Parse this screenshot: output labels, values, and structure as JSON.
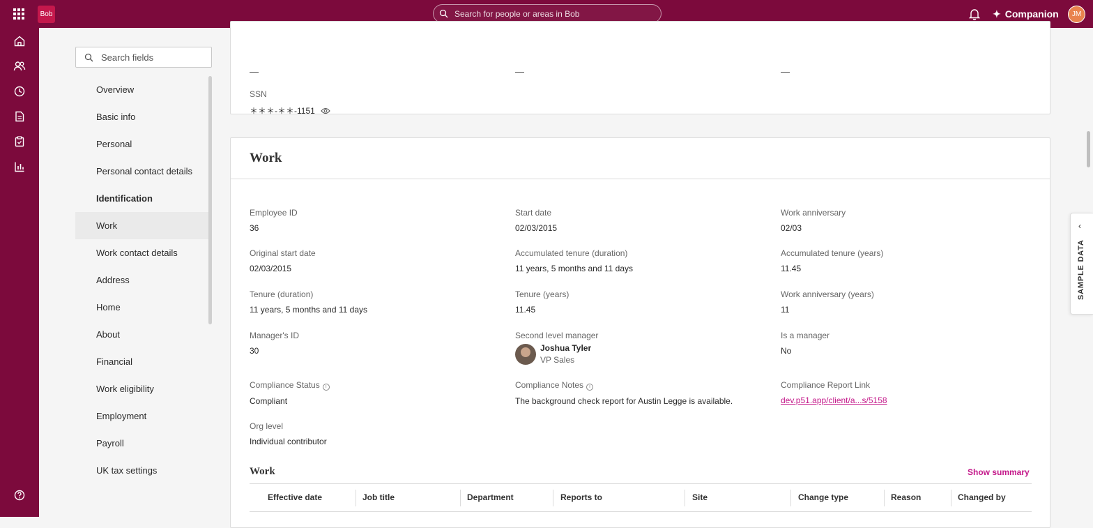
{
  "topbar": {
    "logo_text": "Bob",
    "search_placeholder": "Search for people or areas in Bob",
    "companion_label": "Companion",
    "user_initials": "JM"
  },
  "sidenav": [
    "home-icon",
    "people-icon",
    "time-icon",
    "documents-icon",
    "tasks-icon",
    "analytics-icon",
    "help-icon"
  ],
  "fields": {
    "search_placeholder": "Search fields",
    "items": [
      {
        "label": "Overview"
      },
      {
        "label": "Basic info"
      },
      {
        "label": "Personal"
      },
      {
        "label": "Personal contact details"
      },
      {
        "label": "Identification"
      },
      {
        "label": "Work"
      },
      {
        "label": "Work contact details"
      },
      {
        "label": "Address"
      },
      {
        "label": "Home"
      },
      {
        "label": "About"
      },
      {
        "label": "Financial"
      },
      {
        "label": "Work eligibility"
      },
      {
        "label": "Employment"
      },
      {
        "label": "Payroll"
      },
      {
        "label": "UK tax settings"
      }
    ],
    "bold_item": "Identification",
    "selected_item": "Work"
  },
  "identification": {
    "dash_values": [
      "—",
      "—",
      "—"
    ],
    "ssn_label": "SSN",
    "ssn_value": "＊＊＊-＊＊-1151"
  },
  "work": {
    "title": "Work",
    "employee_id": {
      "label": "Employee ID",
      "value": "36"
    },
    "start_date": {
      "label": "Start date",
      "value": "02/03/2015"
    },
    "work_anniversary": {
      "label": "Work anniversary",
      "value": "02/03"
    },
    "original_start_date": {
      "label": "Original start date",
      "value": "02/03/2015"
    },
    "acc_tenure_duration": {
      "label": "Accumulated tenure (duration)",
      "value": "11 years, 5 months and 11 days"
    },
    "acc_tenure_years": {
      "label": "Accumulated tenure (years)",
      "value": "11.45"
    },
    "tenure_duration": {
      "label": "Tenure (duration)",
      "value": "11 years, 5 months and 11 days"
    },
    "tenure_years": {
      "label": "Tenure (years)",
      "value": "11.45"
    },
    "work_anniversary_years": {
      "label": "Work anniversary (years)",
      "value": "11"
    },
    "managers_id": {
      "label": "Manager's ID",
      "value": "30"
    },
    "second_level_manager": {
      "label": "Second level manager",
      "name": "Joshua Tyler",
      "role": "VP Sales"
    },
    "is_manager": {
      "label": "Is a manager",
      "value": "No"
    },
    "compliance_status": {
      "label": "Compliance Status",
      "value": "Compliant"
    },
    "compliance_notes": {
      "label": "Compliance Notes",
      "value": "The background check report for Austin Legge is available."
    },
    "compliance_report_link": {
      "label": "Compliance Report Link",
      "value": "dev.p51.app/client/a...s/5158"
    },
    "org_level": {
      "label": "Org level",
      "value": "Individual contributor"
    }
  },
  "work_table": {
    "title": "Work",
    "show_summary": "Show summary",
    "columns": [
      "Effective date",
      "Job title",
      "Department",
      "Reports to",
      "Site",
      "Change type",
      "Reason",
      "Changed by"
    ]
  },
  "sample_data": {
    "label": "SAMPLE DATA"
  },
  "colors": {
    "brand": "#7c0a3c",
    "accent": "#c4188a"
  }
}
